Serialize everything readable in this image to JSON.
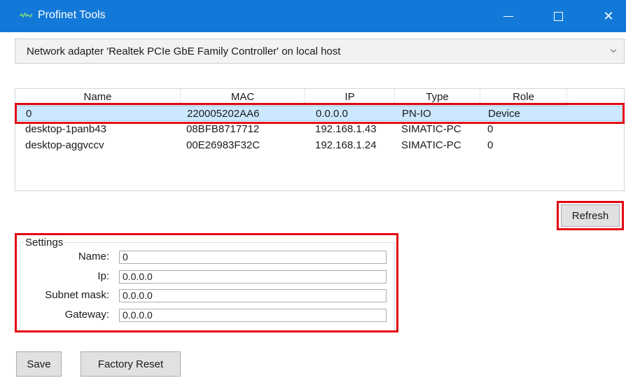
{
  "window": {
    "title": "Profinet Tools",
    "title_bar_color": "#1379d8",
    "icons": {
      "app": "app-icon",
      "minimize": "minimize-icon",
      "maximize": "maximize-icon",
      "close": "close-icon"
    },
    "close_glyph": "✕"
  },
  "adapter": {
    "selected": "Network adapter 'Realtek PCIe GbE Family Controller' on local host"
  },
  "table": {
    "columns": [
      "Name",
      "MAC",
      "IP",
      "Type",
      "Role"
    ],
    "rows": [
      {
        "name": "0",
        "mac": "220005202AA6",
        "ip": "0.0.0.0",
        "type": "PN-IO",
        "role": "Device",
        "selected": true
      },
      {
        "name": "desktop-1panb43",
        "mac": "08BFB8717712",
        "ip": "192.168.1.43",
        "type": "SIMATIC-PC",
        "role": "0"
      },
      {
        "name": "desktop-aggvccv",
        "mac": "00E26983F32C",
        "ip": "192.168.1.24",
        "type": "SIMATIC-PC",
        "role": "0"
      }
    ],
    "selection_color": "#cce8ff"
  },
  "buttons": {
    "refresh": "Refresh",
    "save": "Save",
    "factory_reset": "Factory Reset"
  },
  "settings": {
    "title": "Settings",
    "name_label": "Name:",
    "name_value": "0",
    "ip_label": "Ip:",
    "ip_value": "0.0.0.0",
    "subnet_label": "Subnet mask:",
    "subnet_value": "0.0.0.0",
    "gateway_label": "Gateway:",
    "gateway_value": "0.0.0.0"
  },
  "highlight_color": "#e30613"
}
